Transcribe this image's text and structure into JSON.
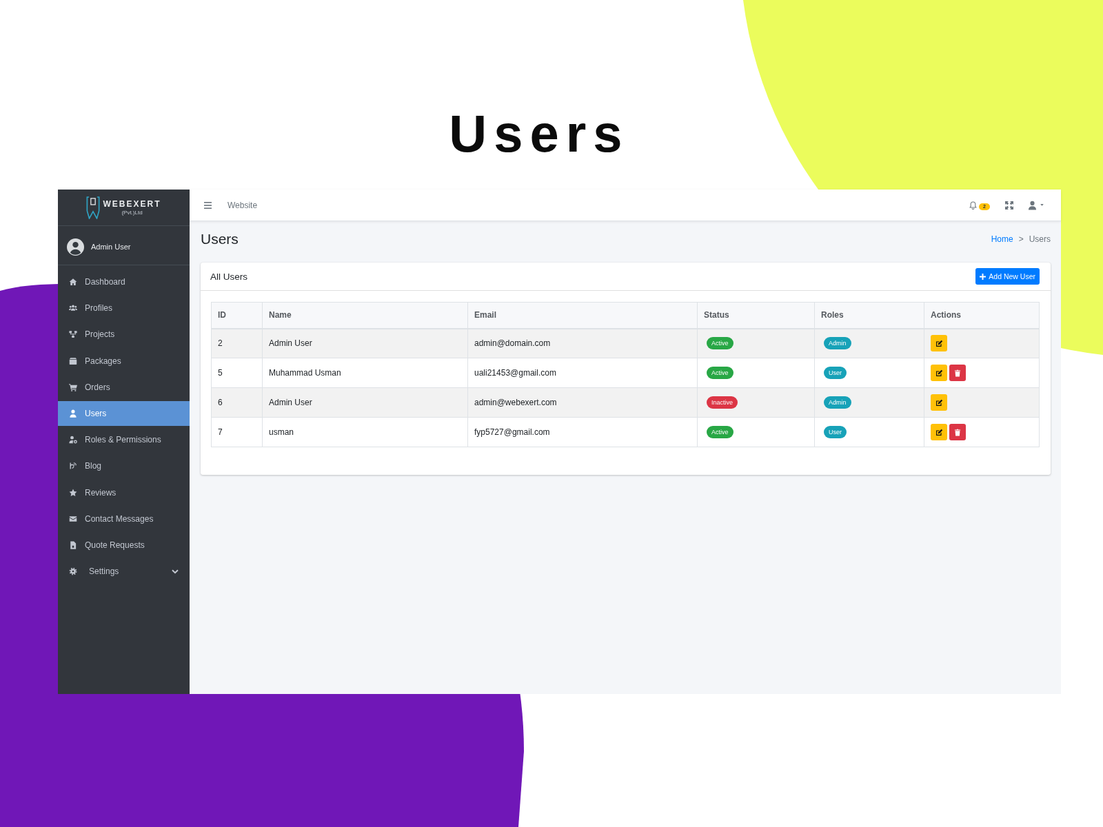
{
  "page_title": "Users",
  "sidebar": {
    "brand": {
      "name": "WEBEXERT",
      "tagline": "(Pvt.)Ltd"
    },
    "user": {
      "name": "Admin User"
    },
    "items": [
      {
        "label": "Dashboard",
        "kind": "link",
        "selected": false
      },
      {
        "label": "Profiles",
        "kind": "link",
        "selected": false
      },
      {
        "label": "Projects",
        "kind": "link",
        "selected": false
      },
      {
        "label": "Packages",
        "kind": "link",
        "selected": false
      },
      {
        "label": "Orders",
        "kind": "link",
        "selected": false
      },
      {
        "label": "Users",
        "kind": "link",
        "selected": true
      },
      {
        "label": "Roles & Permissions",
        "kind": "link",
        "selected": false
      },
      {
        "label": "Blog",
        "kind": "link",
        "selected": false
      },
      {
        "label": "Reviews",
        "kind": "link",
        "selected": false
      },
      {
        "label": "Contact Messages",
        "kind": "link",
        "selected": false
      },
      {
        "label": "Quote Requests",
        "kind": "link",
        "selected": false
      },
      {
        "label": "Settings",
        "kind": "group",
        "selected": false
      }
    ]
  },
  "topbar": {
    "link": "Website",
    "notification_count": "2"
  },
  "content": {
    "title": "Users",
    "breadcrumb": {
      "items": [
        "Home",
        "Users"
      ],
      "separator": ">"
    }
  },
  "card": {
    "title": "All Users",
    "add_button": "Add New User",
    "table": {
      "columns": [
        "ID",
        "Name",
        "Email",
        "Status",
        "Roles",
        "Actions"
      ],
      "rows": [
        {
          "id": "2",
          "name": "Admin User",
          "email": "admin@domain.com",
          "status": {
            "label": "Active",
            "active": true
          },
          "role": "Admin",
          "editable": true,
          "deletable": false
        },
        {
          "id": "5",
          "name": "Muhammad Usman",
          "email": "uali21453@gmail.com",
          "status": {
            "label": "Active",
            "active": true
          },
          "role": "User",
          "editable": true,
          "deletable": true
        },
        {
          "id": "6",
          "name": "Admin User",
          "email": "admin@webexert.com",
          "status": {
            "label": "Inactive",
            "active": false
          },
          "role": "Admin",
          "editable": true,
          "deletable": false
        },
        {
          "id": "7",
          "name": "usman",
          "email": "fyp5727@gmail.com",
          "status": {
            "label": "Active",
            "active": true
          },
          "role": "User",
          "editable": true,
          "deletable": true
        }
      ]
    }
  }
}
